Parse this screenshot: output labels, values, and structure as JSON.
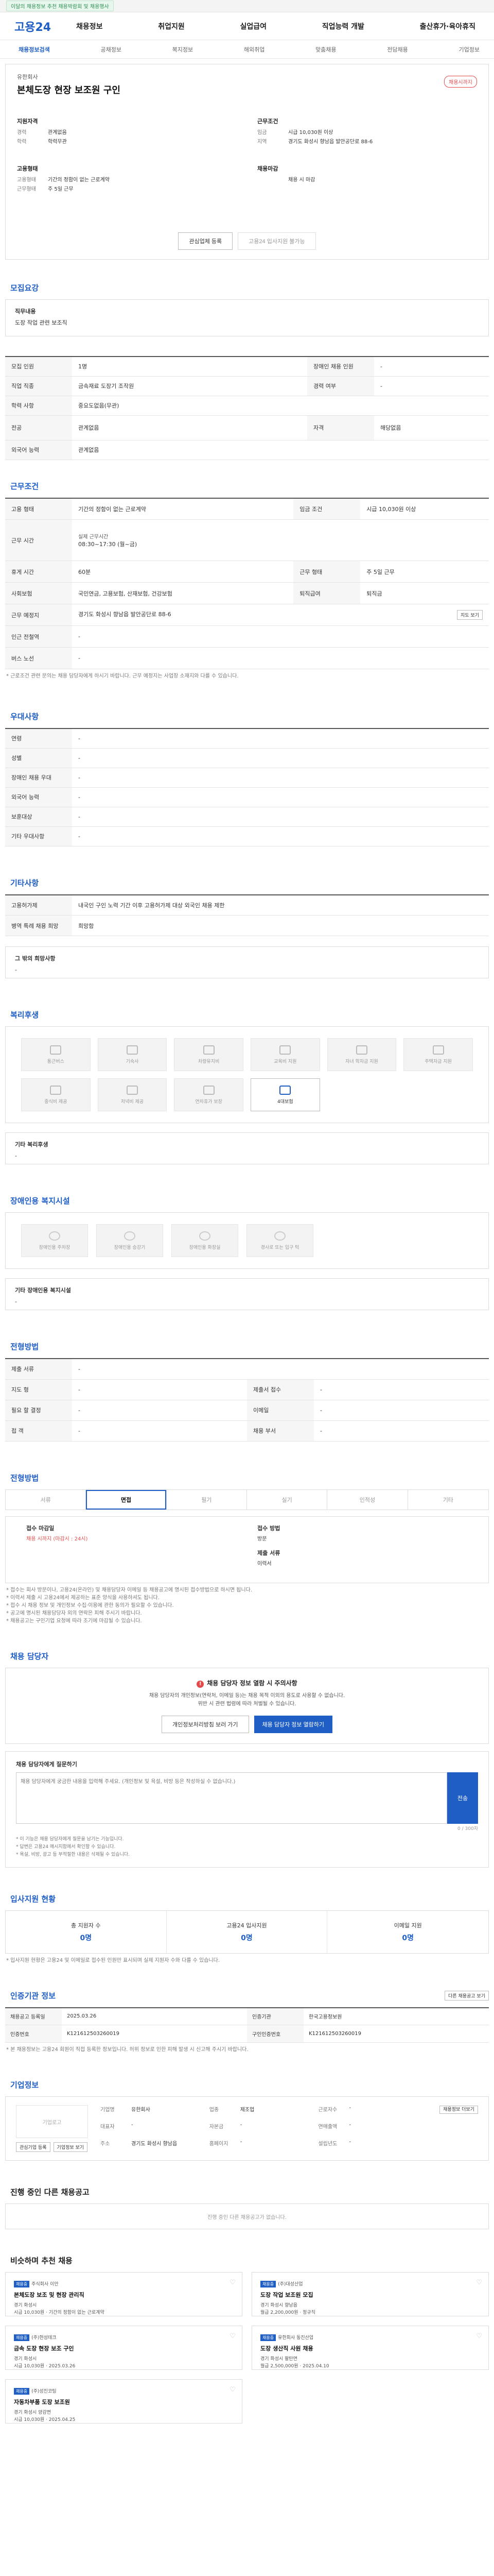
{
  "topbar": {
    "badge": "이달의 채용정보 추천 채용박람회 및 채용행사"
  },
  "header": {
    "logo": "고용24",
    "gnb": [
      "채용정보",
      "취업지원",
      "실업급여",
      "직업능력 개발",
      "출산휴가·육아휴직"
    ]
  },
  "subnav": {
    "items": [
      "채용정보검색",
      "공채정보",
      "복지정보",
      "해외취업",
      "맞춤채용",
      "전담채용",
      "기업정보"
    ],
    "active_index": 0
  },
  "summary": {
    "company": "유한회사",
    "title": "본체도장 현장 보조원 구인",
    "deadline_badge": "채용시까지",
    "block1_title": "지원자격",
    "block1": [
      {
        "k": "경력",
        "v": "관계없음"
      },
      {
        "k": "학력",
        "v": "학력무관"
      }
    ],
    "block2_title": "근무조건",
    "block2": [
      {
        "k": "임금",
        "v": "시급 10,030원 이상"
      },
      {
        "k": "지역",
        "v": "경기도 화성시 향남읍 발안공단로 88-6"
      }
    ],
    "block3_title": "고용형태",
    "block3": [
      {
        "k": "고용형태",
        "v": "기간의 정함이 없는 근로계약"
      },
      {
        "k": "근무형태",
        "v": "주 5일 근무"
      }
    ],
    "block4_title": "채용마감",
    "block4": [
      {
        "k": "",
        "v": "채용 시 마감"
      }
    ],
    "btn_interest": "관심업체 등록",
    "btn_compare": "고용24 입사지원 불가능"
  },
  "sections": {
    "recruit": "모집요강",
    "work": "근무조건",
    "benefit": "우대사항",
    "etc": "기타사항",
    "welfare": "복리후생",
    "disability": "장애인용 복지시설",
    "process": "전형방법",
    "counselor": "채용 담당자",
    "stats": "입사지원 현황",
    "agency": "인증기관 정보",
    "company": "기업정보",
    "other": "진행 중인 다른 채용공고",
    "recommend": "비슷하며 추천 채용"
  },
  "recruit": {
    "job_title": "직무내용",
    "job_desc": "도장 작업 관련 보조직",
    "rows": [
      {
        "k": "모집 인원",
        "v": "1명",
        "k2": "장애인 채용 인원",
        "v2": "-"
      },
      {
        "k": "직업 직종",
        "v": "금속재료 도장기 조작원",
        "k2": "경력 여부",
        "v2": "-"
      },
      {
        "k": "학력 사항",
        "v": "중요도없음(무관)",
        "k2": "",
        "v2": ""
      },
      {
        "k": "전공",
        "v": "관계없음",
        "k2": "자격",
        "v2": "해당없음"
      },
      {
        "k": "외국어 능력",
        "v": "관계없음",
        "k2": "",
        "v2": ""
      }
    ]
  },
  "work": {
    "rows": [
      {
        "k": "고용 형태",
        "v": "기간의 정함이 없는 근로계약",
        "k2": "임금 조건",
        "v2": "시급 10,030원 이상"
      },
      {
        "k": "근무 시간",
        "v": "08:30~17:30 (월~금)",
        "k2": "",
        "v2": ""
      },
      {
        "k": "휴게 시간",
        "v": "60분",
        "k2": "근무 형태",
        "v2": "주 5일 근무"
      },
      {
        "k": "사회보험",
        "v": "국민연금, 고용보험, 산재보험, 건강보험",
        "k2": "퇴직급여",
        "v2": "퇴직금"
      },
      {
        "k": "근무 예정지",
        "v": "경기도 화성시 향남읍 발안공단로 88-6",
        "k2": "",
        "v2": ""
      },
      {
        "k": "인근 전철역",
        "v": "-",
        "k2": "",
        "v2": ""
      },
      {
        "k": "버스 노선",
        "v": "-",
        "k2": "",
        "v2": ""
      }
    ],
    "map_btn": "지도 보기",
    "work_time_extra": "실제 근무시간",
    "note": "* 근로조건 관련 문의는 채용 담당자에게 하시기 바랍니다. 근무 예정지는 사업장 소재지와 다를 수 있습니다."
  },
  "benefit": {
    "rows": [
      {
        "k": "연령",
        "v": "-"
      },
      {
        "k": "성별",
        "v": "-"
      },
      {
        "k": "장애인 채용 우대",
        "v": "-"
      },
      {
        "k": "외국어 능력",
        "v": "-"
      },
      {
        "k": "보훈대상",
        "v": "-"
      },
      {
        "k": "기타 우대사항",
        "v": "-"
      }
    ]
  },
  "etc": {
    "rows": [
      {
        "k": "고용허가제",
        "v": "내국인 구인 노력 기간 이후 고용허가제 대상 외국인 채용 제한"
      },
      {
        "k": "병역 특례 채용 희망",
        "v": "희망함"
      }
    ],
    "box_title": "그 밖의 희망사항",
    "box_desc": "-"
  },
  "welfare": {
    "items": [
      {
        "name": "통근버스",
        "on": false
      },
      {
        "name": "기숙사",
        "on": false
      },
      {
        "name": "차량유지비",
        "on": false
      },
      {
        "name": "교육비 지원",
        "on": false
      },
      {
        "name": "자녀 학자금 지원",
        "on": false
      },
      {
        "name": "주택자금 지원",
        "on": false
      },
      {
        "name": "중식비 제공",
        "on": false
      },
      {
        "name": "저녁비 제공",
        "on": false
      },
      {
        "name": "연차휴가 보장",
        "on": false
      },
      {
        "name": "4대보험",
        "on": true
      }
    ],
    "extra_title": "기타 복리후생",
    "extra_desc": "-"
  },
  "disability": {
    "items": [
      "장애인용 주차장",
      "장애인용 승강기",
      "장애인용 화장실",
      "경사로 또는 입구 턱"
    ],
    "extra_title": "기타 장애인용 복지시설",
    "extra_desc": "-"
  },
  "process": {
    "rows": [
      {
        "k": "제출 서류",
        "v": "-",
        "k2": "",
        "v2": ""
      },
      {
        "k": "지도 형",
        "v": "-",
        "k2": "제출서 접수",
        "v2": "-"
      },
      {
        "k": "필요 할 결정",
        "v": "-",
        "k2": "이메일",
        "v2": "-"
      },
      {
        "k": "접 객",
        "v": "-",
        "k2": "채용 부서",
        "v2": "-"
      }
    ]
  },
  "method": {
    "items": [
      "서류",
      "면접",
      "필기",
      "실기",
      "인적성",
      "기타"
    ],
    "active_index": 1,
    "apply_label": "접수 마감일",
    "apply_value": "채용 시까지 (마감시 : 24시)",
    "apply_label2": "접수 방법",
    "apply_value2": "방문",
    "apply_label3": "제출 서류",
    "apply_value3": "이력서",
    "notes": [
      "* 접수는 회사 방문이나, 고용24(온라인) 및 채용담당자 이메일 등 채용공고에 명시된 접수방법으로 하시면 됩니다.",
      "* 이력서 제출 시 고용24에서 제공하는 표준 양식을 사용하셔도 됩니다.",
      "* 접수 시 채용 정보 및 개인정보 수집·이용에 관한 동의가 필요할 수 있습니다.",
      "* 공고에 명시된 채용담당자 외의 연락은 피해 주시기 바랍니다.",
      "* 채용공고는 구인기업 요청에 따라 조기에 마감될 수 있습니다."
    ]
  },
  "counselor": {
    "warn": "채용 담당자 정보 열람 시 주의사항",
    "desc1": "채용 담당자의 개인정보(연락처, 이메일 등)는 채용 목적 이외의 용도로 사용할 수 없습니다.",
    "desc2": "위반 시 관련 법령에 따라 처벌될 수 있습니다.",
    "btn1": "개인정보처리방침 보러 가기",
    "btn2": "채용 담당자 정보 열람하기",
    "qa_title": "채용 담당자에게 질문하기",
    "qa_placeholder": "채용 담당자에게 궁금한 내용을 입력해 주세요. (개인정보 및 욕설, 비방 등은 작성하실 수 없습니다.)",
    "qa_send": "전송",
    "qa_count": "0 / 300자",
    "bullets": [
      "* 이 기능은 채용 담당자에게 질문을 남기는 기능입니다.",
      "* 답변은 고용24 메시지함에서 확인할 수 있습니다.",
      "* 욕설, 비방, 광고 등 부적절한 내용은 삭제될 수 있습니다."
    ]
  },
  "stats": {
    "items": [
      {
        "label": "총 지원자 수",
        "value": "0명"
      },
      {
        "label": "고용24 입사지원",
        "value": "0명"
      },
      {
        "label": "이메일 지원",
        "value": "0명"
      }
    ],
    "note": "* 입사지원 현황은 고용24 및 이메일로 접수된 인원만 표시되며 실제 지원자 수와 다를 수 있습니다."
  },
  "agency": {
    "rows": [
      {
        "k": "채용공고 등록일",
        "v": "2025.03.26",
        "k2": "인증기관",
        "v2": "한국고용정보원"
      },
      {
        "k": "인증번호",
        "v": "K121612503260019",
        "k2": "구인인증번호",
        "v2": "K121612503260019"
      }
    ],
    "btn": "다른 채용공고 보기",
    "note": "* 본 채용정보는 고용24 회원이 직접 등록한 정보입니다. 허위 정보로 인한 피해 발생 시 신고해 주시기 바랍니다."
  },
  "company": {
    "logo_text": "기업로고",
    "btn1": "관심기업 등록",
    "btn2": "기업정보 보기",
    "rows": [
      {
        "k": "기업명",
        "v": "유한회사",
        "k2": "업종",
        "v2": "제조업",
        "k3": "근로자수",
        "v3": "-"
      },
      {
        "k": "대표자",
        "v": "-",
        "k2": "자본금",
        "v2": "-",
        "k3": "연매출액",
        "v3": "-"
      },
      {
        "k": "주소",
        "v": "경기도 화성시 향남읍",
        "k2": "홈페이지",
        "v2": "-",
        "k3": "설립년도",
        "v3": "-"
      }
    ],
    "btn3": "채용정보 더보기"
  },
  "other": {
    "empty": "진행 중인 다른 채용공고가 없습니다."
  },
  "recommend": {
    "cards": [
      {
        "tag": "채용중",
        "company": "주식회사 이안",
        "title": "본체도장 보조 및 현장 관리직",
        "meta1": "경기 화성시",
        "meta2": "시급 10,030원 · 기간의 정함이 없는 근로계약"
      },
      {
        "tag": "채용중",
        "company": "(주)대성산업",
        "title": "도장 작업 보조원 모집",
        "meta1": "경기 화성시 향남읍",
        "meta2": "월급 2,200,000원 · 정규직"
      },
      {
        "tag": "채용중",
        "company": "(주)현성테크",
        "title": "금속 도장 현장 보조 구인",
        "meta1": "경기 화성시",
        "meta2": "시급 10,030원 · 2025.03.26"
      },
      {
        "tag": "채용중",
        "company": "유한회사 동진산업",
        "title": "도장 생산직 사원 채용",
        "meta1": "경기 화성시 팔탄면",
        "meta2": "월급 2,500,000원 · 2025.04.10"
      },
      {
        "tag": "채용중",
        "company": "(주)성진코팅",
        "title": "자동차부품 도장 보조원",
        "meta1": "경기 화성시 양감면",
        "meta2": "시급 10,030원 · 2025.04.25"
      }
    ]
  }
}
